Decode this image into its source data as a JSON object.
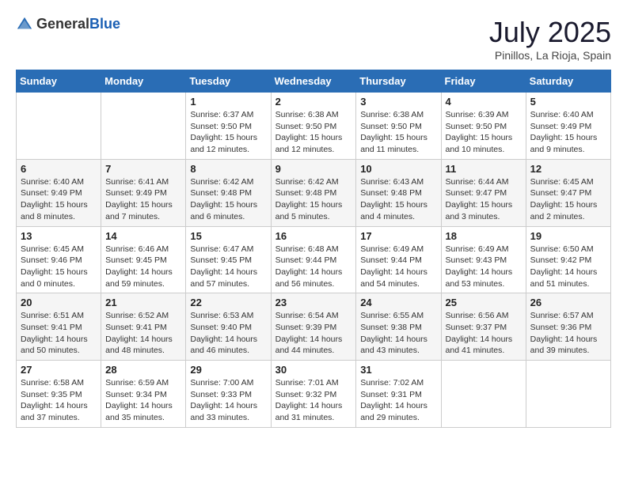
{
  "header": {
    "logo_general": "General",
    "logo_blue": "Blue",
    "month": "July 2025",
    "location": "Pinillos, La Rioja, Spain"
  },
  "days_of_week": [
    "Sunday",
    "Monday",
    "Tuesday",
    "Wednesday",
    "Thursday",
    "Friday",
    "Saturday"
  ],
  "weeks": [
    [
      {
        "day": "",
        "content": ""
      },
      {
        "day": "",
        "content": ""
      },
      {
        "day": "1",
        "content": "Sunrise: 6:37 AM\nSunset: 9:50 PM\nDaylight: 15 hours and 12 minutes."
      },
      {
        "day": "2",
        "content": "Sunrise: 6:38 AM\nSunset: 9:50 PM\nDaylight: 15 hours and 12 minutes."
      },
      {
        "day": "3",
        "content": "Sunrise: 6:38 AM\nSunset: 9:50 PM\nDaylight: 15 hours and 11 minutes."
      },
      {
        "day": "4",
        "content": "Sunrise: 6:39 AM\nSunset: 9:50 PM\nDaylight: 15 hours and 10 minutes."
      },
      {
        "day": "5",
        "content": "Sunrise: 6:40 AM\nSunset: 9:49 PM\nDaylight: 15 hours and 9 minutes."
      }
    ],
    [
      {
        "day": "6",
        "content": "Sunrise: 6:40 AM\nSunset: 9:49 PM\nDaylight: 15 hours and 8 minutes."
      },
      {
        "day": "7",
        "content": "Sunrise: 6:41 AM\nSunset: 9:49 PM\nDaylight: 15 hours and 7 minutes."
      },
      {
        "day": "8",
        "content": "Sunrise: 6:42 AM\nSunset: 9:48 PM\nDaylight: 15 hours and 6 minutes."
      },
      {
        "day": "9",
        "content": "Sunrise: 6:42 AM\nSunset: 9:48 PM\nDaylight: 15 hours and 5 minutes."
      },
      {
        "day": "10",
        "content": "Sunrise: 6:43 AM\nSunset: 9:48 PM\nDaylight: 15 hours and 4 minutes."
      },
      {
        "day": "11",
        "content": "Sunrise: 6:44 AM\nSunset: 9:47 PM\nDaylight: 15 hours and 3 minutes."
      },
      {
        "day": "12",
        "content": "Sunrise: 6:45 AM\nSunset: 9:47 PM\nDaylight: 15 hours and 2 minutes."
      }
    ],
    [
      {
        "day": "13",
        "content": "Sunrise: 6:45 AM\nSunset: 9:46 PM\nDaylight: 15 hours and 0 minutes."
      },
      {
        "day": "14",
        "content": "Sunrise: 6:46 AM\nSunset: 9:45 PM\nDaylight: 14 hours and 59 minutes."
      },
      {
        "day": "15",
        "content": "Sunrise: 6:47 AM\nSunset: 9:45 PM\nDaylight: 14 hours and 57 minutes."
      },
      {
        "day": "16",
        "content": "Sunrise: 6:48 AM\nSunset: 9:44 PM\nDaylight: 14 hours and 56 minutes."
      },
      {
        "day": "17",
        "content": "Sunrise: 6:49 AM\nSunset: 9:44 PM\nDaylight: 14 hours and 54 minutes."
      },
      {
        "day": "18",
        "content": "Sunrise: 6:49 AM\nSunset: 9:43 PM\nDaylight: 14 hours and 53 minutes."
      },
      {
        "day": "19",
        "content": "Sunrise: 6:50 AM\nSunset: 9:42 PM\nDaylight: 14 hours and 51 minutes."
      }
    ],
    [
      {
        "day": "20",
        "content": "Sunrise: 6:51 AM\nSunset: 9:41 PM\nDaylight: 14 hours and 50 minutes."
      },
      {
        "day": "21",
        "content": "Sunrise: 6:52 AM\nSunset: 9:41 PM\nDaylight: 14 hours and 48 minutes."
      },
      {
        "day": "22",
        "content": "Sunrise: 6:53 AM\nSunset: 9:40 PM\nDaylight: 14 hours and 46 minutes."
      },
      {
        "day": "23",
        "content": "Sunrise: 6:54 AM\nSunset: 9:39 PM\nDaylight: 14 hours and 44 minutes."
      },
      {
        "day": "24",
        "content": "Sunrise: 6:55 AM\nSunset: 9:38 PM\nDaylight: 14 hours and 43 minutes."
      },
      {
        "day": "25",
        "content": "Sunrise: 6:56 AM\nSunset: 9:37 PM\nDaylight: 14 hours and 41 minutes."
      },
      {
        "day": "26",
        "content": "Sunrise: 6:57 AM\nSunset: 9:36 PM\nDaylight: 14 hours and 39 minutes."
      }
    ],
    [
      {
        "day": "27",
        "content": "Sunrise: 6:58 AM\nSunset: 9:35 PM\nDaylight: 14 hours and 37 minutes."
      },
      {
        "day": "28",
        "content": "Sunrise: 6:59 AM\nSunset: 9:34 PM\nDaylight: 14 hours and 35 minutes."
      },
      {
        "day": "29",
        "content": "Sunrise: 7:00 AM\nSunset: 9:33 PM\nDaylight: 14 hours and 33 minutes."
      },
      {
        "day": "30",
        "content": "Sunrise: 7:01 AM\nSunset: 9:32 PM\nDaylight: 14 hours and 31 minutes."
      },
      {
        "day": "31",
        "content": "Sunrise: 7:02 AM\nSunset: 9:31 PM\nDaylight: 14 hours and 29 minutes."
      },
      {
        "day": "",
        "content": ""
      },
      {
        "day": "",
        "content": ""
      }
    ]
  ]
}
